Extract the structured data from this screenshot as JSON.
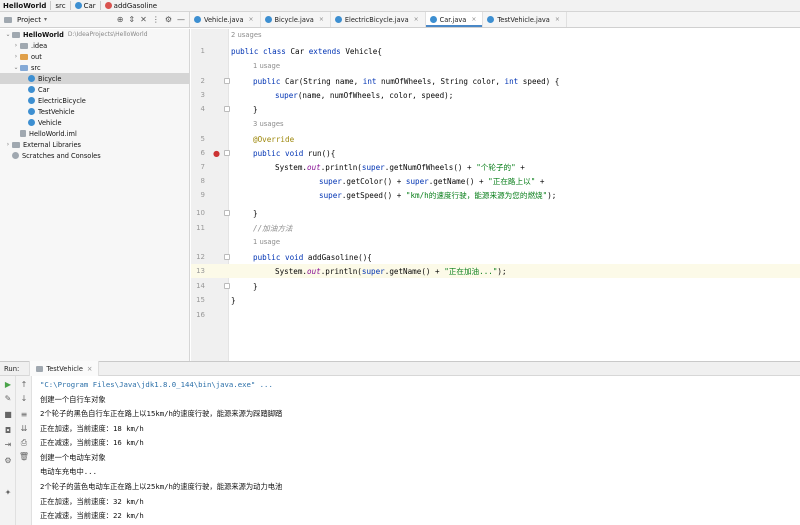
{
  "breadcrumb": {
    "project": "HelloWorld",
    "folder": "src",
    "class_name": "Car",
    "method": "addGasoline"
  },
  "project_panel": {
    "selector_label": "Project",
    "tree": [
      {
        "label": "HelloWorld",
        "path": "D:\\IdeaProjects\\HelloWorld",
        "kind": "module",
        "depth": 0,
        "expanded": true
      },
      {
        "label": ".idea",
        "kind": "folder",
        "depth": 1,
        "expanded": false
      },
      {
        "label": "out",
        "kind": "folder-orange",
        "depth": 1,
        "expanded": false
      },
      {
        "label": "src",
        "kind": "folder",
        "depth": 1,
        "expanded": true
      },
      {
        "label": "Bicycle",
        "kind": "class",
        "depth": 2,
        "selected": true
      },
      {
        "label": "Car",
        "kind": "class",
        "depth": 2
      },
      {
        "label": "ElectricBicycle",
        "kind": "class",
        "depth": 2
      },
      {
        "label": "TestVehicle",
        "kind": "class",
        "depth": 2
      },
      {
        "label": "Vehicle",
        "kind": "class",
        "depth": 2
      },
      {
        "label": "HelloWorld.iml",
        "kind": "file",
        "depth": 1
      },
      {
        "label": "External Libraries",
        "kind": "lib",
        "depth": 0,
        "expanded": false
      },
      {
        "label": "Scratches and Consoles",
        "kind": "scratch",
        "depth": 0
      }
    ]
  },
  "tabs": [
    {
      "label": "Vehicle.java",
      "active": false
    },
    {
      "label": "Bicycle.java",
      "active": false
    },
    {
      "label": "ElectricBicycle.java",
      "active": false
    },
    {
      "label": "Car.java",
      "active": true
    },
    {
      "label": "TestVehicle.java",
      "active": false
    }
  ],
  "editor": {
    "current_line": 13,
    "line_numbers": [
      "1",
      "2",
      "3",
      "4",
      "5",
      "6",
      "7",
      "8",
      "9",
      "10",
      "11",
      "12",
      "13",
      "14",
      "15",
      "16"
    ],
    "usages": {
      "class": "2 usages",
      "constructor": "1 usage",
      "run": "3 usages",
      "addGasoline": "1 usage"
    },
    "lines": {
      "l1": {
        "kw1": "public class ",
        "name": "Car ",
        "kw2": "extends ",
        "rest": "Vehicle{"
      },
      "l2": {
        "kw1": "public ",
        "name": "Car",
        "p1": "(String name, ",
        "kw2": "int ",
        "p2": "numOfWheels, String color, ",
        "kw3": "int ",
        "p3": "speed) {"
      },
      "l3": {
        "sup": "super",
        "rest": "(name, numOfWheels, color, speed);"
      },
      "l4": "}",
      "l5": "@Override",
      "l6": {
        "kw": "public void ",
        "rest": "run(){"
      },
      "l7": {
        "a": "System.",
        "fld": "out",
        "b": ".println(",
        "sup": "super",
        "c": ".getNumOfWheels() + ",
        "str": "\"个轮子的\"",
        "d": " +"
      },
      "l8": {
        "sup1": "super",
        "a": ".getColor() + ",
        "sup2": "super",
        "b": ".getName() + ",
        "str": "\"正在路上以\"",
        "c": " +"
      },
      "l9": {
        "sup": "super",
        "a": ".getSpeed() + ",
        "str": "\"km/h的速度行驶，能源来源为您的燃烧\"",
        "b": ");"
      },
      "l10": "}",
      "l11": "//加油方法",
      "l12": {
        "kw": "public void ",
        "rest": "addGasoline(){"
      },
      "l13": {
        "a": "System.",
        "fld": "out",
        "b": ".println(",
        "sup": "super",
        "c": ".getName() + ",
        "str": "\"正在加油...\"",
        "d": ");"
      },
      "l14": "}",
      "l15": "}"
    }
  },
  "run": {
    "label": "Run:",
    "tab": "TestVehicle",
    "output": [
      "\"C:\\Program Files\\Java\\jdk1.8.0_144\\bin\\java.exe\" ...",
      "创建一个自行车对象",
      "2个轮子的黑色自行车正在路上以15km/h的速度行驶，能源来源为踩踏脚踏",
      "正在加速，当前速度：18 km/h",
      "正在减速，当前速度：16 km/h",
      "创建一个电动车对象",
      "电动车充电中...",
      "2个轮子的蓝色电动车正在路上以25km/h的速度行驶，能源来源为动力电池",
      "正在加速，当前速度：32 km/h",
      "正在减速，当前速度：22 km/h"
    ]
  },
  "colors": {
    "keyword": "#0033b3",
    "string": "#067d17",
    "annotation": "#9e880d",
    "comment": "#8c8c8c",
    "class_icon": "#3d8fd1",
    "active_tab_underline": "#4a88c7"
  }
}
